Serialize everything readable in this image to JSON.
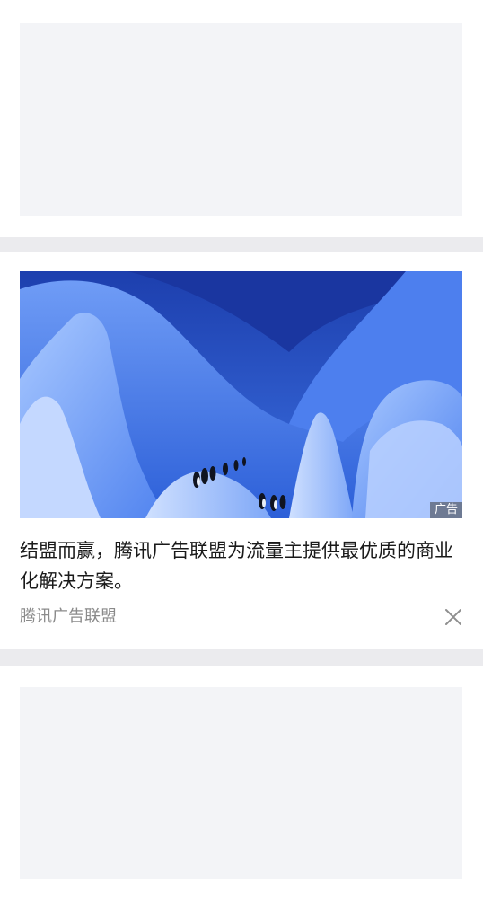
{
  "ad": {
    "badge": "广告",
    "headline": "结盟而赢，腾讯广告联盟为流量主提供最优质的商业化解决方案。",
    "source": "腾讯广告联盟",
    "image": "ice-cave-penguins-photo",
    "close_icon": "close-icon"
  },
  "colors": {
    "gap": "#ebebee",
    "placeholder": "#f3f4f7",
    "text": "#1a1a1a",
    "muted": "#8a8a8a"
  }
}
